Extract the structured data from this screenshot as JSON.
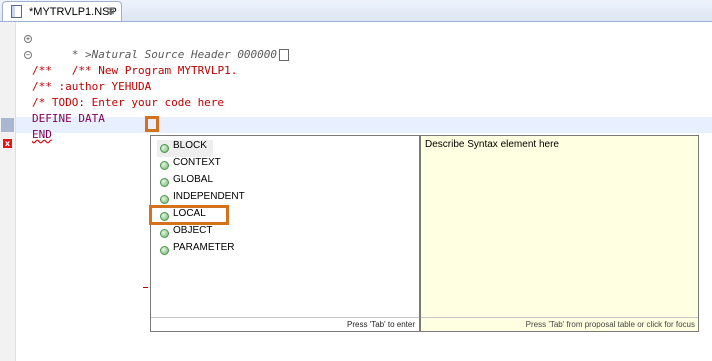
{
  "tab": {
    "title": "*MYTRVLP1.NSP",
    "close_label": "⊠"
  },
  "code": {
    "lines": [
      {
        "text": "* >Natural Source Header 000000"
      },
      {
        "text": "/** New Program MYTRVLP1."
      },
      {
        "text": "/**"
      },
      {
        "text": "/** :author YEHUDA"
      },
      {
        "text": "/* TODO: Enter your code here"
      },
      {
        "text": "DEFINE DATA"
      },
      {
        "text": "END"
      }
    ]
  },
  "proposals": {
    "items": [
      "BLOCK",
      "CONTEXT",
      "GLOBAL",
      "INDEPENDENT",
      "LOCAL",
      "OBJECT",
      "PARAMETER"
    ],
    "selected": "BLOCK",
    "status": "Press 'Tab' to enter"
  },
  "description": {
    "text": "Describe Syntax element here",
    "status": "Press 'Tab' from proposal table or click for focus"
  }
}
